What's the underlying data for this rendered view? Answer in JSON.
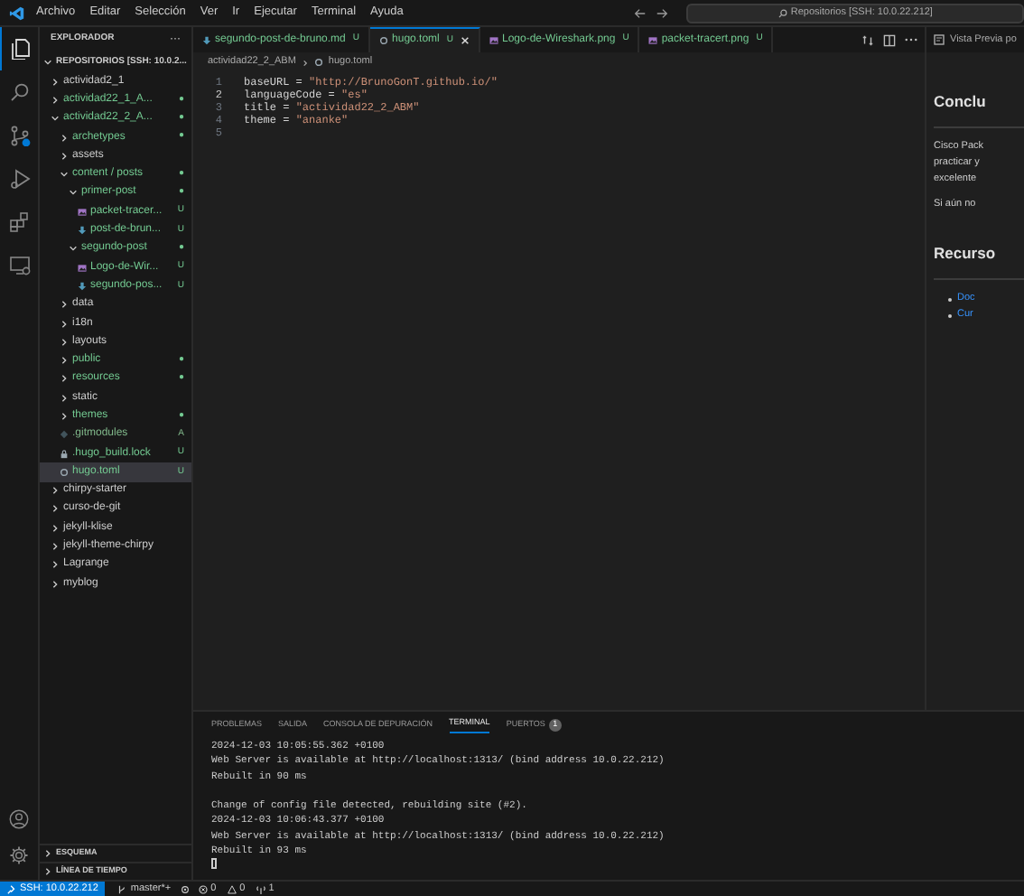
{
  "menu": [
    "Archivo",
    "Editar",
    "Selección",
    "Ver",
    "Ir",
    "Ejecutar",
    "Terminal",
    "Ayuda"
  ],
  "command_center": {
    "placeholder": "Repositorios [SSH: 10.0.22.212]"
  },
  "activity_bar": [
    {
      "kind": "explorer",
      "selected": true
    },
    {
      "kind": "search",
      "selected": false
    },
    {
      "kind": "source-control",
      "selected": false
    },
    {
      "kind": "run",
      "selected": false
    },
    {
      "kind": "extensions",
      "selected": false
    },
    {
      "kind": "remote",
      "selected": false
    }
  ],
  "sidebar": {
    "title": "EXPLORADOR",
    "more": "···",
    "root": "REPOSITORIOS [SSH: 10.0.2...",
    "tree": [
      {
        "label": "actividad2_1",
        "kind": "folder",
        "expanded": false,
        "color": "#cccccc",
        "selected": false
      },
      {
        "label": "actividad22_1_A...",
        "kind": "folder",
        "expanded": false,
        "color": "#73c991",
        "badge": "●",
        "selected": false
      },
      {
        "label": "actividad22_2_A...",
        "kind": "folder",
        "expanded": true,
        "color": "#73c991",
        "badge": "●",
        "selected": false,
        "children": [
          {
            "label": "archetypes",
            "kind": "folder",
            "expanded": false,
            "color": "#73c991",
            "badge": "●",
            "selected": false
          },
          {
            "label": "assets",
            "kind": "folder",
            "expanded": false,
            "color": "#cccccc",
            "selected": false
          },
          {
            "label": "content / posts",
            "kind": "folder",
            "expanded": true,
            "color": "#73c991",
            "badge": "●",
            "selected": false,
            "children": [
              {
                "label": "primer-post",
                "kind": "folder",
                "expanded": true,
                "color": "#73c991",
                "badge": "●",
                "selected": false,
                "children": [
                  {
                    "label": "packet-tracer...",
                    "kind": "image",
                    "color": "#73c991",
                    "badge": "U",
                    "selected": false
                  },
                  {
                    "label": "post-de-brun...",
                    "kind": "markdown",
                    "color": "#73c991",
                    "badge": "U",
                    "selected": false
                  }
                ]
              },
              {
                "label": "segundo-post",
                "kind": "folder",
                "expanded": true,
                "color": "#73c991",
                "badge": "●",
                "selected": false,
                "children": [
                  {
                    "label": "Logo-de-Wir...",
                    "kind": "image",
                    "color": "#73c991",
                    "badge": "U",
                    "selected": false
                  },
                  {
                    "label": "segundo-pos...",
                    "kind": "markdown",
                    "color": "#73c991",
                    "badge": "U",
                    "selected": false
                  }
                ]
              }
            ]
          },
          {
            "label": "data",
            "kind": "folder",
            "expanded": false,
            "color": "#cccccc",
            "selected": false
          },
          {
            "label": "i18n",
            "kind": "folder",
            "expanded": false,
            "color": "#cccccc",
            "selected": false
          },
          {
            "label": "layouts",
            "kind": "folder",
            "expanded": false,
            "color": "#cccccc",
            "selected": false
          },
          {
            "label": "public",
            "kind": "folder",
            "expanded": false,
            "color": "#73c991",
            "badge": "●",
            "selected": false
          },
          {
            "label": "resources",
            "kind": "folder",
            "expanded": false,
            "color": "#73c991",
            "badge": "●",
            "selected": false
          },
          {
            "label": "static",
            "kind": "folder",
            "expanded": false,
            "color": "#cccccc",
            "selected": false
          },
          {
            "label": "themes",
            "kind": "folder",
            "expanded": false,
            "color": "#73c991",
            "badge": "●",
            "selected": false
          },
          {
            "label": ".gitmodules",
            "kind": "gitfile",
            "color": "#81b88b",
            "badge": "A",
            "selected": false
          },
          {
            "label": ".hugo_build.lock",
            "kind": "lock",
            "color": "#73c991",
            "badge": "U",
            "selected": false
          },
          {
            "label": "hugo.toml",
            "kind": "config",
            "color": "#73c991",
            "badge": "U",
            "selected": true
          }
        ]
      },
      {
        "label": "chirpy-starter",
        "kind": "folder",
        "expanded": false,
        "color": "#cccccc",
        "selected": false
      },
      {
        "label": "curso-de-git",
        "kind": "folder",
        "expanded": false,
        "color": "#cccccc",
        "selected": false
      },
      {
        "label": "jekyll-klise",
        "kind": "folder",
        "expanded": false,
        "color": "#cccccc",
        "selected": false
      },
      {
        "label": "jekyll-theme-chirpy",
        "kind": "folder",
        "expanded": false,
        "color": "#cccccc",
        "selected": false
      },
      {
        "label": "Lagrange",
        "kind": "folder",
        "expanded": false,
        "color": "#cccccc",
        "selected": false
      },
      {
        "label": "myblog",
        "kind": "folder",
        "expanded": false,
        "color": "#cccccc",
        "selected": false
      }
    ],
    "sections": [
      {
        "label": "ESQUEMA",
        "expanded": false
      },
      {
        "label": "LÍNEA DE TIEMPO",
        "expanded": false
      }
    ]
  },
  "tabs": [
    {
      "label": "segundo-post-de-bruno.md",
      "kind": "markdown",
      "badge": "U",
      "selected": false
    },
    {
      "label": "hugo.toml",
      "kind": "config",
      "badge": "U",
      "selected": true
    },
    {
      "label": "Logo-de-Wireshark.png",
      "kind": "image",
      "badge": "U",
      "selected": false
    },
    {
      "label": "packet-tracert.png",
      "kind": "image",
      "badge": "U",
      "selected": false
    }
  ],
  "breadcrumb": [
    "actividad22_2_ABM",
    "hugo.toml"
  ],
  "editor_lines": [
    {
      "number": "1",
      "key": "baseURL",
      "op": "=",
      "value": "\"http://BrunoGonT.github.io/\"",
      "current": false
    },
    {
      "number": "2",
      "key": "languageCode",
      "op": "=",
      "value": "\"es\"",
      "current": true
    },
    {
      "number": "3",
      "key": "title",
      "op": "=",
      "value": "\"actividad22_2_ABM\"",
      "current": false
    },
    {
      "number": "4",
      "key": "theme",
      "op": "=",
      "value": "\"ananke\"",
      "current": false
    },
    {
      "number": "5",
      "current": false
    }
  ],
  "preview": {
    "tab": "Vista Previa po",
    "blocks": [
      {
        "kind": "heading",
        "text": "Conclu"
      },
      {
        "kind": "paragraph",
        "lines": [
          "Cisco Pack",
          "practicar y",
          "excelente"
        ]
      },
      {
        "kind": "paragraph",
        "lines": [
          "Si aún no"
        ]
      },
      {
        "kind": "heading",
        "text": "Recurso"
      },
      {
        "kind": "links",
        "items": [
          "Doc",
          "Cur"
        ]
      }
    ]
  },
  "panel": {
    "tabs": [
      {
        "label": "PROBLEMAS",
        "selected": false
      },
      {
        "label": "SALIDA",
        "selected": false
      },
      {
        "label": "CONSOLA DE DEPURACIÓN",
        "selected": false
      },
      {
        "label": "TERMINAL",
        "selected": true
      },
      {
        "label": "PUERTOS",
        "count": "1",
        "selected": false
      }
    ],
    "terminal": [
      [
        "2024-12-03 10:05:55.362 +0100",
        "Web Server is available at http://localhost:1313/ (bind address 10.0.22.212)",
        "Rebuilt in 90 ms"
      ],
      [
        "Change of config file detected, rebuilding site (#2).",
        "2024-12-03 10:06:43.377 +0100",
        "Web Server is available at http://localhost:1313/ (bind address 10.0.22.212)",
        "Rebuilt in 93 ms"
      ]
    ]
  },
  "status_bar": {
    "remote": "SSH: 10.0.22.212",
    "branch": "master*+",
    "errors": "0",
    "warnings": "0",
    "ports": "1"
  }
}
